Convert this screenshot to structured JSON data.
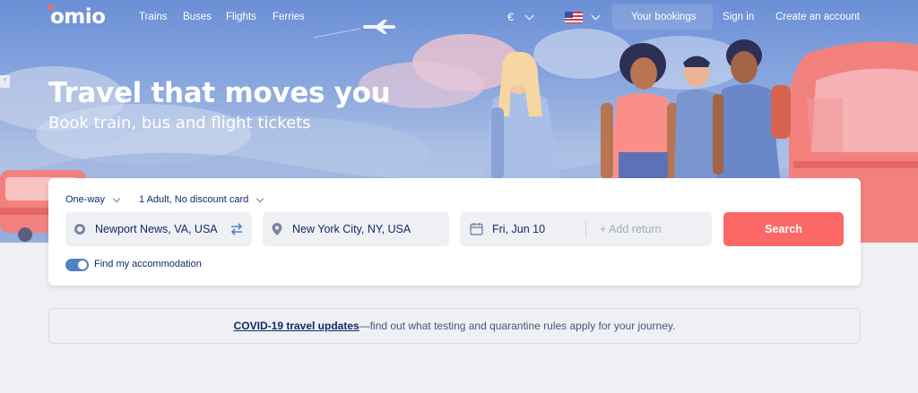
{
  "brand": {
    "logo_text": "omio",
    "accent_color": "#fc6865",
    "primary_text_color": "#132968"
  },
  "nav": {
    "links": [
      "Trains",
      "Buses",
      "Flights",
      "Ferries"
    ],
    "currency": "€",
    "flag_icon": "us-flag-icon",
    "your_bookings": "Your bookings",
    "sign_in": "Sign in",
    "create_account": "Create an account"
  },
  "hero": {
    "headline": "Travel that moves you",
    "subline": "Book train, bus and flight tickets"
  },
  "search": {
    "trip_type": "One-way",
    "passengers": "1 Adult, No discount card",
    "origin": "Newport News, VA, USA",
    "destination": "New York City, NY, USA",
    "date": "Fri, Jun 10",
    "return_placeholder": "+ Add return",
    "search_label": "Search",
    "accommodation_label": "Find my accommodation",
    "accommodation_on": true
  },
  "banner": {
    "link_text": "COVID-19 travel updates",
    "rest_text": "—find out what testing and quarantine rules apply for your journey."
  }
}
